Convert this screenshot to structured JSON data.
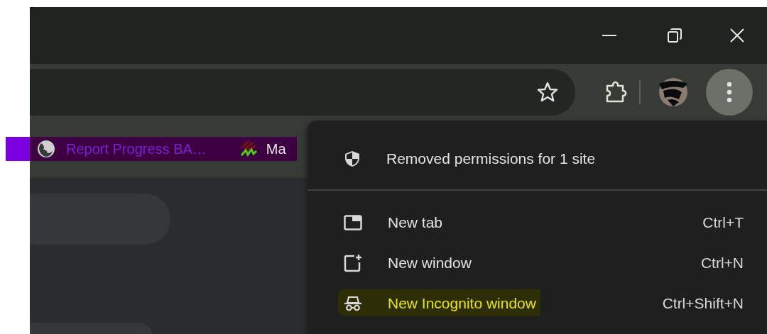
{
  "bookmarks": [
    {
      "kind": "globe",
      "label": "Report Progress BA…",
      "highlighted": true
    },
    {
      "kind": "site",
      "label": "Ma",
      "highlighted": false
    }
  ],
  "menu": {
    "sections": [
      [
        {
          "kind": "shield",
          "label": "Removed permissions for 1 site",
          "highlighted": false
        }
      ],
      [
        {
          "kind": "tab",
          "label": "New tab",
          "shortcut": "Ctrl+T",
          "highlighted": false
        },
        {
          "kind": "window",
          "label": "New window",
          "shortcut": "Ctrl+N",
          "highlighted": false
        },
        {
          "kind": "incognito",
          "label": "New Incognito window",
          "shortcut": "Ctrl+Shift+N",
          "highlighted": true
        }
      ]
    ]
  }
}
